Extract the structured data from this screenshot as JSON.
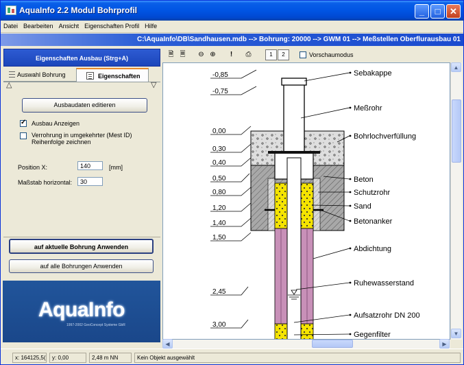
{
  "window": {
    "title": "AquaInfo 2.2  Modul Bohrprofil",
    "controls": {
      "minimize": "_",
      "maximize": "□",
      "close": "✕"
    }
  },
  "menu": [
    "Datei",
    "Bearbeiten",
    "Ansicht",
    "Eigenschaften Profil",
    "Hilfe"
  ],
  "pathbar": "C:\\AquaInfo\\DB\\Sandhausen.mdb --> Bohrung: 20000 --> GWM 01 --> Meßstellen Oberflurausbau 01",
  "left": {
    "header": "Eigenschaften Ausbau (Strg+A)",
    "tabs": [
      "Auswahl Bohrung",
      "Eigenschaften"
    ],
    "edit_button": "Ausbaudaten editieren",
    "show_ausbau": {
      "label": "Ausbau Anzeigen",
      "checked": true
    },
    "reverse_order": {
      "label": "Verrohrung in umgekehrter (Mest ID) Reihenfolge zeichnen",
      "checked": false
    },
    "position_x": {
      "label": "Position X:",
      "value": "140",
      "unit": "[mm]"
    },
    "scale_horizontal": {
      "label": "Maßstab horizontal:",
      "value": "30"
    },
    "apply_current": "auf aktuelle Bohrung Anwenden",
    "apply_all": "auf alle Bohrungen Anwenden"
  },
  "logo": {
    "text": "AquaInfo",
    "subtitle": "1997-2002 GeoConcept Systeme GbR"
  },
  "toolbar": {
    "buttons": [
      "page-preview-icon",
      "page-setup-icon",
      "zoom-out-icon",
      "zoom-in-icon",
      "info-icon",
      "print-icon",
      "page-1-icon",
      "page-2-icon"
    ],
    "page1": "1",
    "page2": "2",
    "exclaim": "!",
    "preview_mode": {
      "label": "Vorschaumodus",
      "checked": false
    }
  },
  "profile": {
    "depths": [
      "-0,85",
      "-0,75",
      "0,00",
      "0,30",
      "0,40",
      "0,50",
      "0,80",
      "1,20",
      "1,40",
      "1,50",
      "2,45",
      "3,00"
    ],
    "labels": [
      "Sebakappe",
      "Meßrohr",
      "Bohrlochverfüllung",
      "Beton",
      "Schutzrohr",
      "Sand",
      "Betonanker",
      "Abdichtung",
      "Ruhewasserstand",
      "Aufsatzrohr DN 200",
      "Gegenfilter"
    ]
  },
  "status": {
    "x": "x: 164125,5(",
    "y": "y: 0,00",
    "nn": "2,48 m NN",
    "selection": "Kein Objekt ausgewählt"
  },
  "colors": {
    "title_blue": "#0054e3",
    "path_blue": "#1b4bcf",
    "sand_yellow": "#f5e400",
    "seal_pink": "#c890b8",
    "concrete_gray": "#9a9a9a",
    "logo_blue": "#21559b"
  }
}
